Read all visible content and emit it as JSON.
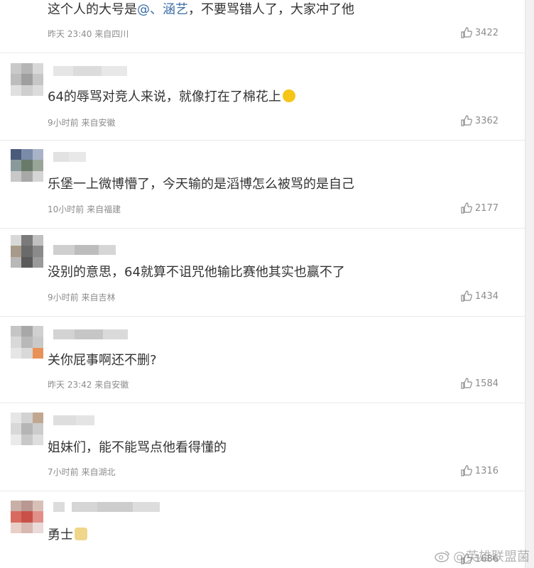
{
  "comments": [
    {
      "text_before": "这个人的大号是",
      "mention": "@、涵艺",
      "text_after": "，不要骂错人了，大家冲了他",
      "time": "昨天 23:40 来自四川",
      "likes": "3422"
    },
    {
      "text": "64的辱骂对竞人来说，就像打在了棉花上",
      "emoji": "laugh-cry-emoji",
      "time": "9小时前 来自安徽",
      "likes": "3362"
    },
    {
      "text": "乐堡一上微博懵了，今天输的是滔博怎么被骂的是自己",
      "time": "10小时前 来自福建",
      "likes": "2177"
    },
    {
      "text": "没别的意思，64就算不诅咒他输比赛他其实也赢不了",
      "time": "9小时前 来自吉林",
      "likes": "1434"
    },
    {
      "text": "关你屁事啊还不删?",
      "time": "昨天 23:42 来自安徽",
      "likes": "1584"
    },
    {
      "text": "姐妹们，能不能骂点他看得懂的",
      "time": "7小时前 来自湖北",
      "likes": "1316"
    },
    {
      "text": "勇士",
      "emoji": "doge-emoji",
      "time": "",
      "likes": "1686"
    }
  ],
  "watermark": "@英雄联盟菌",
  "colors": {
    "mention": "#3a6ea5",
    "meta": "#8c8c8c"
  }
}
